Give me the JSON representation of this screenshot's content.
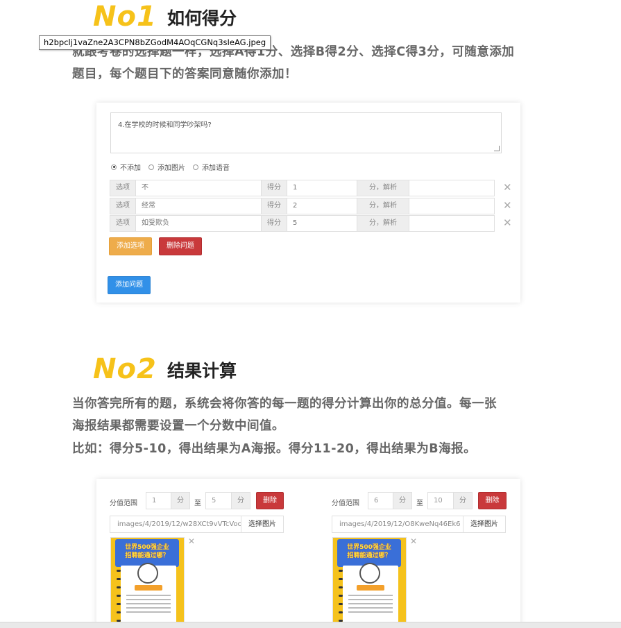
{
  "tooltip": "h2bpclj1vaZne2A3CPN8bZGodM4AOqCGNq3sIeAG.jpeg",
  "section1": {
    "no": "No1",
    "title": "如何得分",
    "line1": "就跟考卷的选择题一样，选择A得1分、选择B得2分、选择C得3分，可随意添加",
    "line2": "题目，每个题目下的答案同意随你添加！"
  },
  "question_card": {
    "question_text": "4.在学校的时候和同学吵架吗?",
    "media_options": [
      {
        "label": "不添加",
        "checked": true
      },
      {
        "label": "添加图片",
        "checked": false
      },
      {
        "label": "添加语音",
        "checked": false
      }
    ],
    "option_prefix": "选项",
    "score_label": "得分",
    "analysis_label": "分，解析",
    "options": [
      {
        "text": "不",
        "score": "1",
        "analysis": ""
      },
      {
        "text": "经常",
        "score": "2",
        "analysis": ""
      },
      {
        "text": "如受欺负",
        "score": "5",
        "analysis": ""
      }
    ],
    "add_option_button": "添加选项",
    "delete_question_button": "删除问题",
    "add_question_button": "添加问题"
  },
  "section2": {
    "no": "No2",
    "title": "结果计算",
    "line1": "当你答完所有的题，系统会将你答的每一题的得分计算出你的总分值。每一张",
    "line2": "海报结果都需要设置一个分数中间值。",
    "line3": "比如：得分5-10，得出结果为A海报。得分11-20，得出结果为B海报。"
  },
  "result_card": {
    "range_label": "分值范围",
    "unit": "分",
    "to": "至",
    "delete_button": "删除",
    "pick_image_button": "选择图片",
    "results": [
      {
        "from": "1",
        "to": "5",
        "path": "images/4/2019/12/w28XCt9vVTcVoc",
        "poster_title": "世界500强企业\n招聘能通过哪？"
      },
      {
        "from": "6",
        "to": "10",
        "path": "images/4/2019/12/O8KweNq46Ek6",
        "poster_title": "世界500强企业\n招聘能通过哪？"
      }
    ]
  }
}
